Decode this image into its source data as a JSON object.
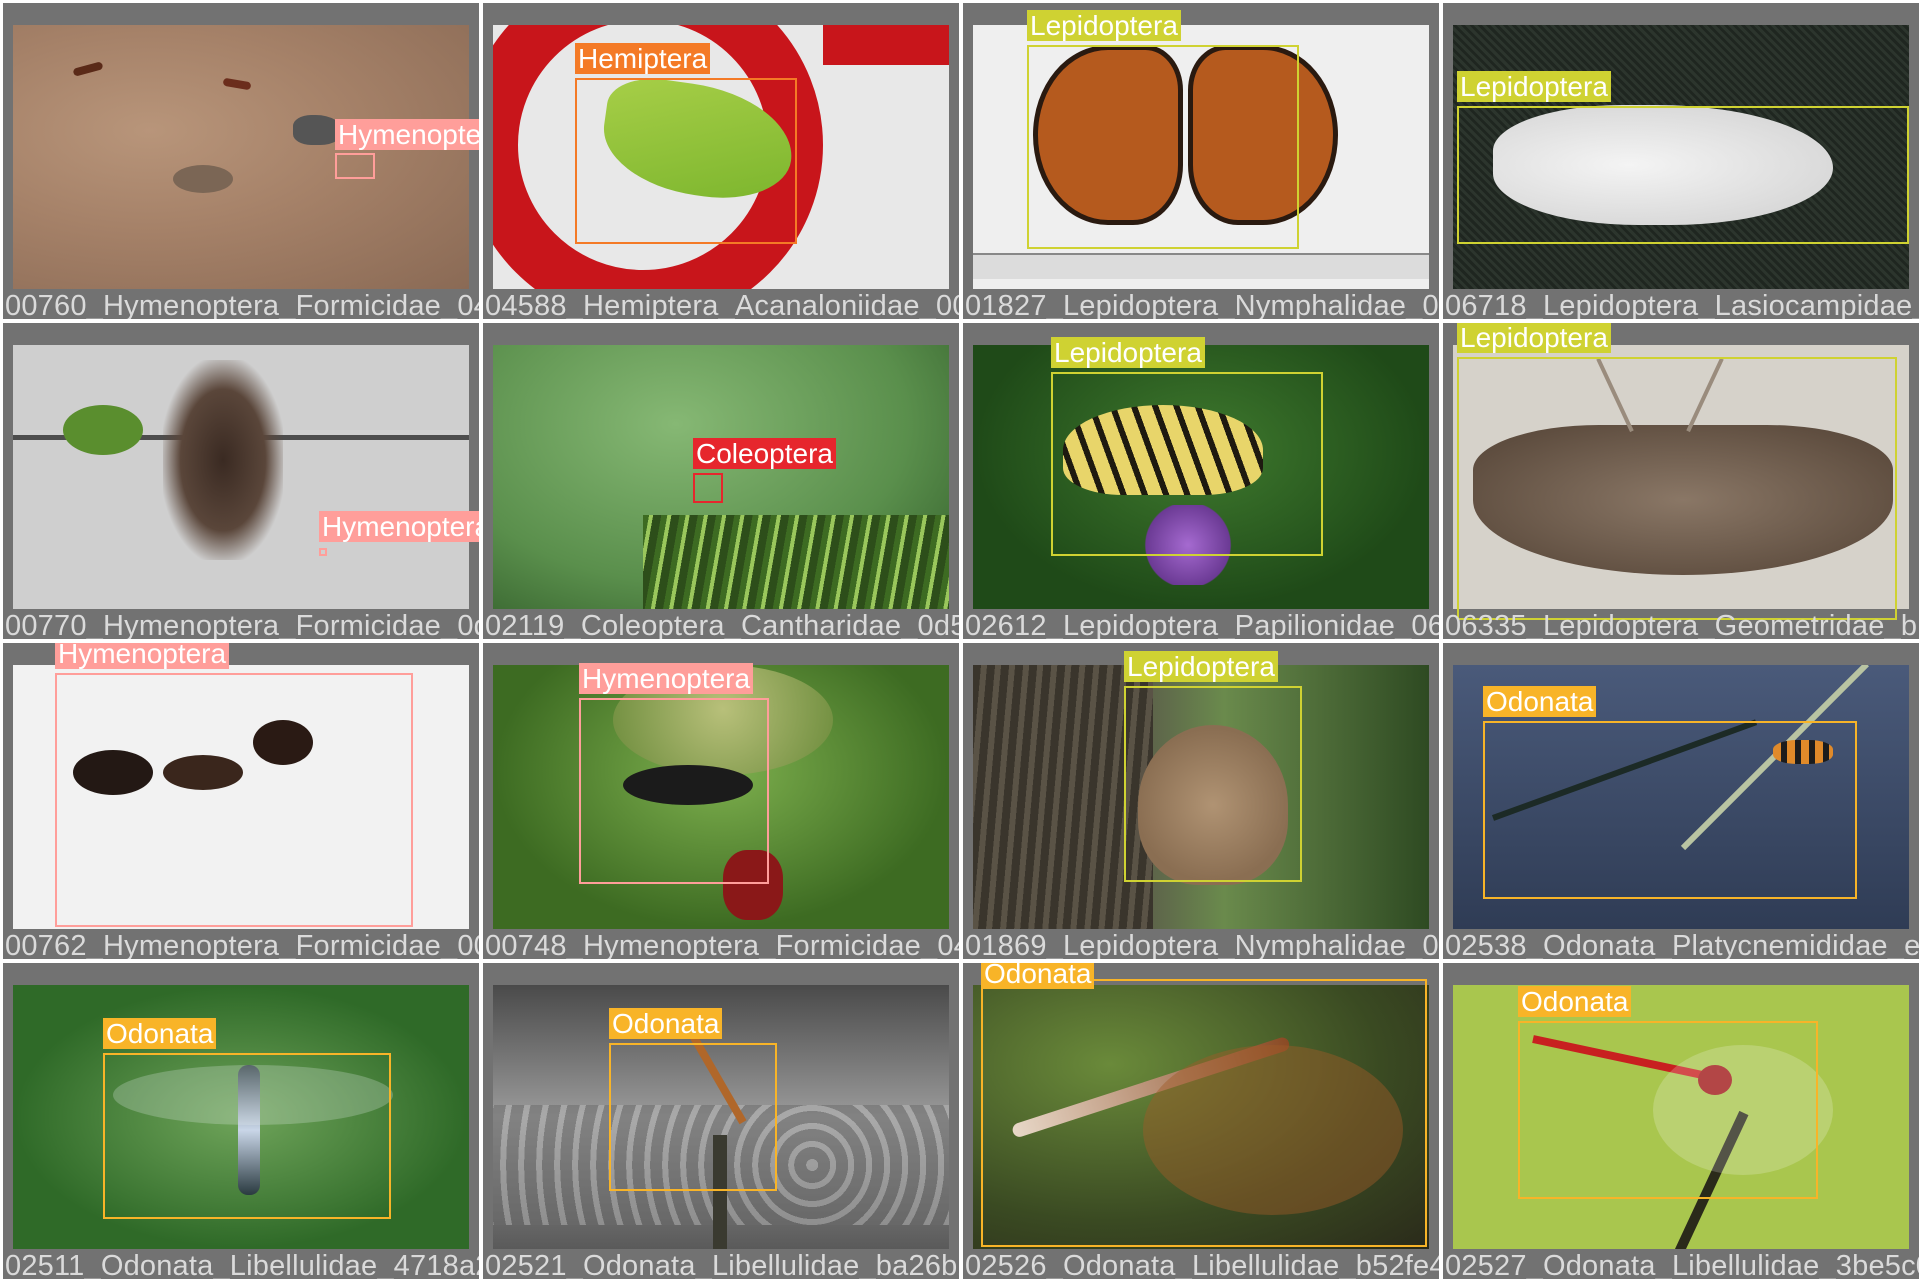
{
  "colors": {
    "Hymenoptera": "#ff9e9a",
    "Hemiptera": "#f47a26",
    "Lepidoptera": "#cfd232",
    "Coleoptera": "#e6262d",
    "Odonata": "#f8b428"
  },
  "tiles": [
    {
      "filename": "00760_Hymenoptera_Formicidae_0456bcf7eceb",
      "label": "Hymenoptera",
      "cls": "Hymenoptera",
      "scene": "ants on sandy ground"
    },
    {
      "filename": "04588_Hemiptera_Acanaloniidae_00b29f44b5ab",
      "label": "Hemiptera",
      "cls": "Hemiptera",
      "scene": "green planthopper on red and white surface"
    },
    {
      "filename": "01827_Lepidoptera_Nymphalidae_0fa7d4e0e123",
      "label": "Lepidoptera",
      "cls": "Lepidoptera",
      "scene": "orange butterfly above a ruler"
    },
    {
      "filename": "06718_Lepidoptera_Lasiocampidae_e6e57c39fa5b",
      "label": "Lepidoptera",
      "cls": "Lepidoptera",
      "scene": "white fluffy moth on mesh"
    },
    {
      "filename": "00770_Hymenoptera_Formicidae_0d195bc99c46",
      "label": "Hymenoptera",
      "cls": "Hymenoptera",
      "scene": "ant swarm on concrete"
    },
    {
      "filename": "02119_Coleoptera_Cantharidae_0d5fd05a3e6d",
      "label": "Coleoptera",
      "cls": "Coleoptera",
      "scene": "small beetle on green leaves"
    },
    {
      "filename": "02612_Lepidoptera_Papilionidae_06a2c12ee8a1",
      "label": "Lepidoptera",
      "cls": "Lepidoptera",
      "scene": "tiger swallowtail on purple flowers"
    },
    {
      "filename": "06335_Lepidoptera_Geometridae_b13e72e1f6ac",
      "label": "Lepidoptera",
      "cls": "Lepidoptera",
      "scene": "brown geometrid moth"
    },
    {
      "filename": "00762_Hymenoptera_Formicidae_00c4b8a7ab91",
      "label": "Hymenoptera",
      "cls": "Hymenoptera",
      "scene": "ant close-up on white"
    },
    {
      "filename": "00748_Hymenoptera_Formicidae_04f9c3b0a2e8",
      "label": "Hymenoptera",
      "cls": "Hymenoptera",
      "scene": "ants on green fruit"
    },
    {
      "filename": "01869_Lepidoptera_Nymphalidae_05d7e0cf9a4b",
      "label": "Lepidoptera",
      "cls": "Lepidoptera",
      "scene": "brown butterfly on tree bark"
    },
    {
      "filename": "02538_Odonata_Platycnemididae_e0a1c5f7b3d2",
      "label": "Odonata",
      "cls": "Odonata",
      "scene": "damselfly on grass stem"
    },
    {
      "filename": "02511_Odonata_Libellulidae_4718a2c1c03f",
      "label": "Odonata",
      "cls": "Odonata",
      "scene": "dragonfly among green leaves"
    },
    {
      "filename": "02521_Odonata_Libellulidae_ba26b27c8d6e",
      "label": "Odonata",
      "cls": "Odonata",
      "scene": "dragonfly on stick over water"
    },
    {
      "filename": "02526_Odonata_Libellulidae_b52fe4a7c1d4",
      "label": "Odonata",
      "cls": "Odonata",
      "scene": "dragonfly close-up among plants"
    },
    {
      "filename": "02527_Odonata_Libellulidae_3be5c09d8a17",
      "label": "Odonata",
      "cls": "Odonata",
      "scene": "red dragonfly on twig"
    }
  ]
}
